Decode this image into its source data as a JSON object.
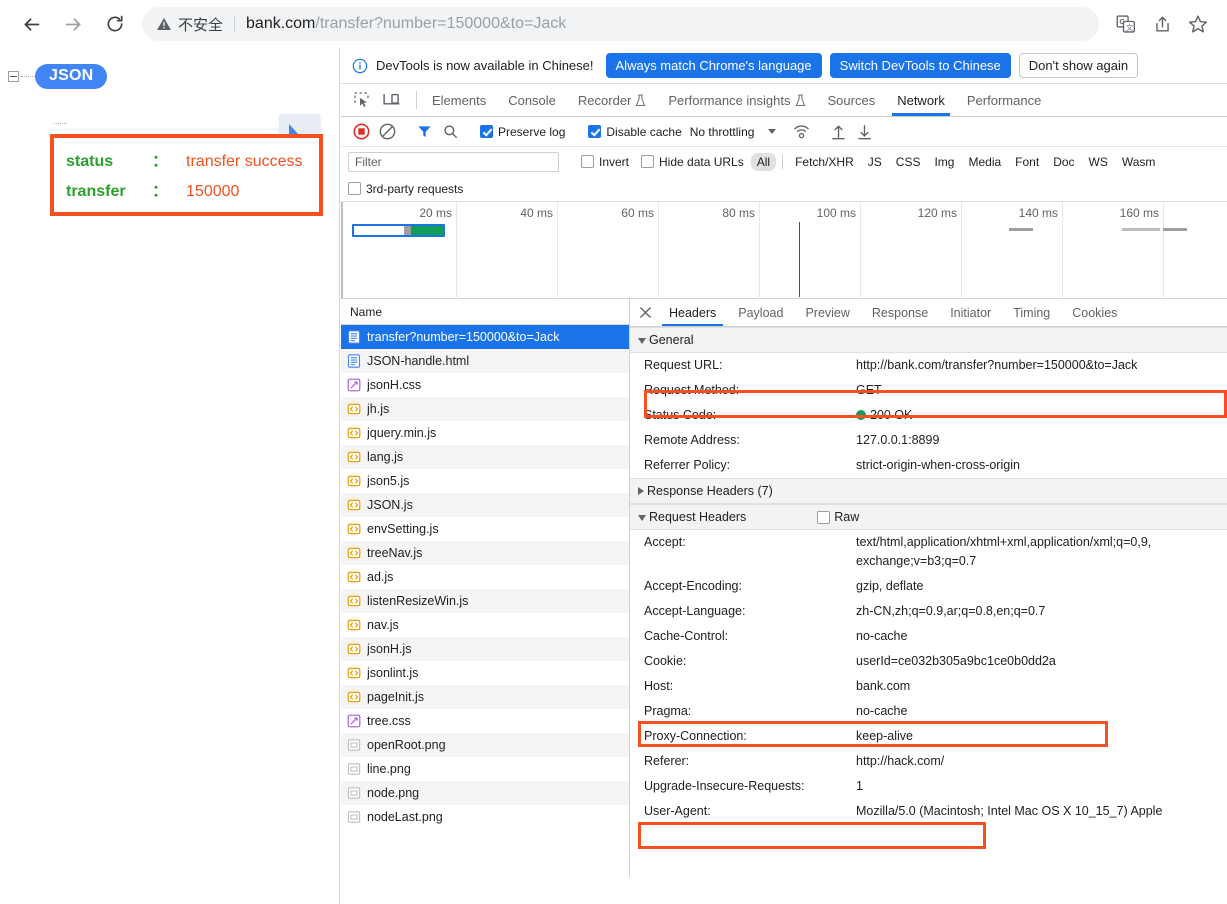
{
  "browser": {
    "back_label": "back-arrow",
    "forward_label": "forward-arrow",
    "reload_label": "reload",
    "security_text": "不安全",
    "url_host": "bank.com",
    "url_path": "/transfer?number=150000&to=Jack",
    "icons": [
      "translate-icon",
      "share-icon",
      "bookmark-star-icon"
    ]
  },
  "page": {
    "root_label": "JSON",
    "fields": [
      {
        "key": "status",
        "colon": "：",
        "value": "transfer success"
      },
      {
        "key": "transfer",
        "colon": "：",
        "value": "150000"
      }
    ]
  },
  "devtools": {
    "notification": {
      "message": "DevTools is now available in Chinese!",
      "btn_always": "Always match Chrome's language",
      "btn_switch": "Switch DevTools to Chinese",
      "btn_dismiss": "Don't show again"
    },
    "panel_tabs": [
      {
        "label": "Elements",
        "active": false,
        "flask": false
      },
      {
        "label": "Console",
        "active": false,
        "flask": false
      },
      {
        "label": "Recorder",
        "active": false,
        "flask": true
      },
      {
        "label": "Performance insights",
        "active": false,
        "flask": true
      },
      {
        "label": "Sources",
        "active": false,
        "flask": false
      },
      {
        "label": "Network",
        "active": true,
        "flask": false
      },
      {
        "label": "Performance",
        "active": false,
        "flask": false
      }
    ],
    "network_toolbar": {
      "record_icon": "record-stop-icon",
      "clear_icon": "clear-icon",
      "filter_icon": "funnel-icon",
      "search_icon": "search-icon",
      "preserve_log": "Preserve log",
      "preserve_log_checked": true,
      "disable_cache": "Disable cache",
      "disable_cache_checked": true,
      "throttling": "No throttling",
      "wifi_icon": "network-conditions-icon",
      "import_icon": "import-har-icon",
      "export_icon": "export-har-icon"
    },
    "filter_bar": {
      "placeholder": "Filter",
      "invert": "Invert",
      "hide_data_urls": "Hide data URLs",
      "types": [
        "All",
        "Fetch/XHR",
        "JS",
        "CSS",
        "Img",
        "Media",
        "Font",
        "Doc",
        "WS",
        "Wasm"
      ],
      "selected_type": "All",
      "third_party": "3rd-party requests"
    },
    "overview": {
      "ticks": [
        "20 ms",
        "40 ms",
        "60 ms",
        "80 ms",
        "100 ms",
        "120 ms",
        "140 ms",
        "160 ms"
      ]
    },
    "request_list": {
      "column_header": "Name",
      "rows": [
        {
          "name": "transfer?number=150000&to=Jack",
          "icon": "doc-icon",
          "selected": true
        },
        {
          "name": "JSON-handle.html",
          "icon": "doc-icon",
          "selected": false
        },
        {
          "name": "jsonH.css",
          "icon": "css-icon",
          "selected": false
        },
        {
          "name": "jh.js",
          "icon": "js-icon",
          "selected": false
        },
        {
          "name": "jquery.min.js",
          "icon": "js-icon",
          "selected": false
        },
        {
          "name": "lang.js",
          "icon": "js-icon",
          "selected": false
        },
        {
          "name": "json5.js",
          "icon": "js-icon",
          "selected": false
        },
        {
          "name": "JSON.js",
          "icon": "js-icon",
          "selected": false
        },
        {
          "name": "envSetting.js",
          "icon": "js-icon",
          "selected": false
        },
        {
          "name": "treeNav.js",
          "icon": "js-icon",
          "selected": false
        },
        {
          "name": "ad.js",
          "icon": "js-icon",
          "selected": false
        },
        {
          "name": "listenResizeWin.js",
          "icon": "js-icon",
          "selected": false
        },
        {
          "name": "nav.js",
          "icon": "js-icon",
          "selected": false
        },
        {
          "name": "jsonH.js",
          "icon": "js-icon",
          "selected": false
        },
        {
          "name": "jsonlint.js",
          "icon": "js-icon",
          "selected": false
        },
        {
          "name": "pageInit.js",
          "icon": "js-icon",
          "selected": false
        },
        {
          "name": "tree.css",
          "icon": "css-icon",
          "selected": false
        },
        {
          "name": "openRoot.png",
          "icon": "img-icon",
          "selected": false
        },
        {
          "name": "line.png",
          "icon": "img-icon",
          "selected": false
        },
        {
          "name": "node.png",
          "icon": "img-icon",
          "selected": false
        },
        {
          "name": "nodeLast.png",
          "icon": "img-icon",
          "selected": false
        }
      ]
    },
    "detail_tabs": [
      {
        "label": "Headers",
        "active": true
      },
      {
        "label": "Payload",
        "active": false
      },
      {
        "label": "Preview",
        "active": false
      },
      {
        "label": "Response",
        "active": false
      },
      {
        "label": "Initiator",
        "active": false
      },
      {
        "label": "Timing",
        "active": false
      },
      {
        "label": "Cookies",
        "active": false
      }
    ],
    "sections": {
      "general_title": "General",
      "response_headers_title": "Response Headers (7)",
      "request_headers_title": "Request Headers",
      "raw_label": "Raw"
    },
    "general": [
      {
        "key": "Request URL:",
        "value": "http://bank.com/transfer?number=150000&to=Jack",
        "highlight": true
      },
      {
        "key": "Request Method:",
        "value": "GET",
        "highlight": false
      },
      {
        "key": "Status Code:",
        "value": "200 OK",
        "highlight": false,
        "dot": true
      },
      {
        "key": "Remote Address:",
        "value": "127.0.0.1:8899",
        "highlight": false
      },
      {
        "key": "Referrer Policy:",
        "value": "strict-origin-when-cross-origin",
        "highlight": false
      }
    ],
    "request_headers": [
      {
        "key": "Accept:",
        "value": "text/html,application/xhtml+xml,application/xml;q=0,9,   exchange;v=b3;q=0.7",
        "wrap": true
      },
      {
        "key": "Accept-Encoding:",
        "value": "gzip, deflate"
      },
      {
        "key": "Accept-Language:",
        "value": "zh-CN,zh;q=0.9,ar;q=0.8,en;q=0.7"
      },
      {
        "key": "Cache-Control:",
        "value": "no-cache"
      },
      {
        "key": "Cookie:",
        "value": "userId=ce032b305a9bc1ce0b0dd2a",
        "highlight": true
      },
      {
        "key": "Host:",
        "value": "bank.com"
      },
      {
        "key": "Pragma:",
        "value": "no-cache"
      },
      {
        "key": "Proxy-Connection:",
        "value": "keep-alive"
      },
      {
        "key": "Referer:",
        "value": "http://hack.com/",
        "highlight": true
      },
      {
        "key": "Upgrade-Insecure-Requests:",
        "value": "1"
      },
      {
        "key": "User-Agent:",
        "value": "Mozilla/5.0 (Macintosh; Intel Mac OS X 10_15_7) Apple"
      }
    ]
  },
  "colors": {
    "accent_blue": "#1a73e8",
    "annotation_orange": "#f4511e",
    "key_green": "#2ca02c",
    "value_orange": "#f4511e",
    "status_green": "#0f9d58"
  }
}
